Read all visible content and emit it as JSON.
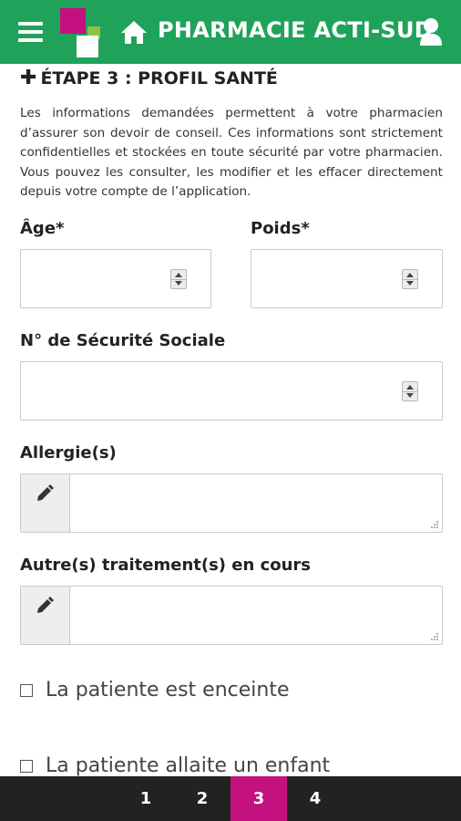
{
  "header": {
    "title": "PHARMACIE ACTI-SUD",
    "menu_icon": "hamburger-icon",
    "home_icon": "home-icon",
    "user_icon": "user-icon",
    "brand_colors": {
      "bar": "#1fa35a",
      "magenta": "#c4117f",
      "lime": "#8bc34a"
    }
  },
  "step": {
    "heading": "ÉTAPE 3 : PROFIL SANTÉ",
    "intro": "Les informations demandées permettent à votre pharmacien d’assurer son devoir de conseil. Ces informations sont strictement confidentielles et stockées en toute sécurité par votre pharmacien. Vous pouvez les consulter, les modifier et les effacer directement depuis votre compte de l’application."
  },
  "form": {
    "age_label": "Âge*",
    "age_value": "",
    "weight_label": "Poids*",
    "weight_value": "",
    "ssn_label": "N° de Sécurité Sociale",
    "ssn_value": "",
    "allergies_label": "Allergie(s)",
    "allergies_value": "",
    "treatments_label": "Autre(s) traitement(s) en cours",
    "treatments_value": "",
    "pregnant_label": "La patiente est enceinte",
    "pregnant_checked": false,
    "breastfeeding_label": "La patiente allaite un enfant",
    "breastfeeding_checked": false
  },
  "pager": {
    "pages": [
      "1",
      "2",
      "3",
      "4"
    ],
    "active": "3",
    "active_color": "#c4117f"
  }
}
